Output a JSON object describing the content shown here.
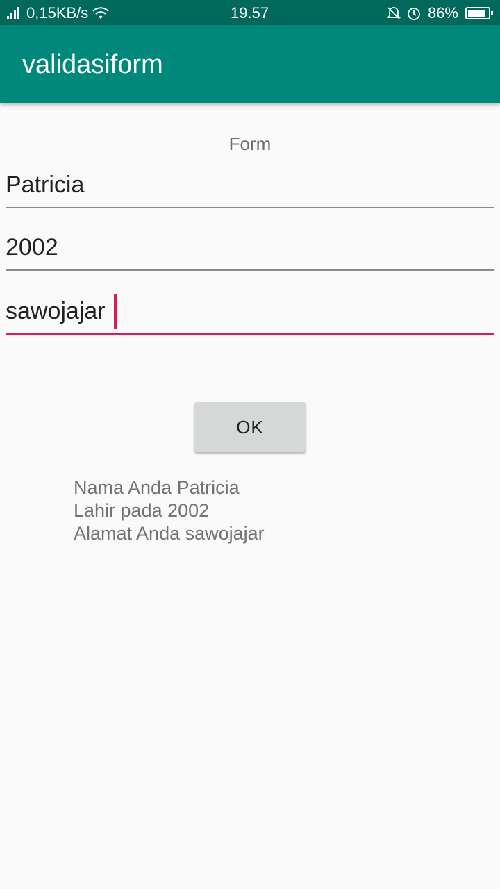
{
  "status_bar": {
    "network_speed": "0,15KB/s",
    "time": "19.57",
    "battery_percent": "86%",
    "battery_level": 0.86,
    "icons": [
      "signal-icon",
      "wifi-icon",
      "mute-icon",
      "alarm-icon",
      "battery-icon"
    ]
  },
  "app_bar": {
    "title": "validasiform",
    "color": "#00897b"
  },
  "form": {
    "label": "Form",
    "fields": [
      {
        "name": "name-input",
        "value": "Patricia"
      },
      {
        "name": "birth-year-input",
        "value": "2002"
      },
      {
        "name": "address-input",
        "value": "sawojajar",
        "focused": true
      }
    ],
    "accent_color": "#d81b60"
  },
  "button": {
    "label": "OK"
  },
  "result": {
    "line1": "Nama Anda Patricia",
    "line2": "Lahir pada 2002",
    "line3": "Alamat Anda sawojajar"
  }
}
